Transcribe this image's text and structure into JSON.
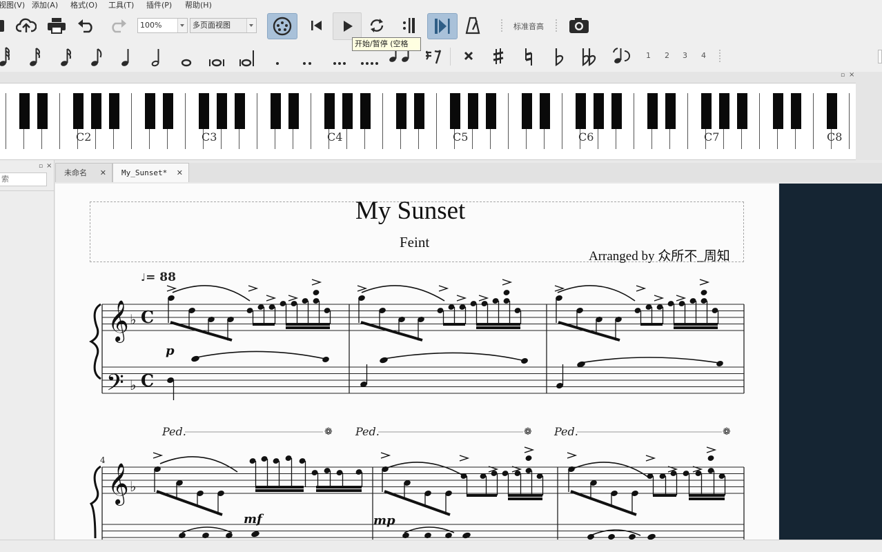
{
  "menu": [
    "视图(V)",
    "添加(A)",
    "格式(O)",
    "工具(T)",
    "插件(P)",
    "帮助(H)"
  ],
  "toolbar": {
    "zoom_value": "100%",
    "view_mode": "多页面视图",
    "concert_pitch_label": "标准音高",
    "tooltip": "开始/暂停 (空格"
  },
  "palette": {
    "voices": [
      "1",
      "2",
      "3",
      "4"
    ]
  },
  "piano": {
    "labels": [
      "C2",
      "C3",
      "C4",
      "C5",
      "C6",
      "C7",
      "C8"
    ]
  },
  "left_dock": {
    "search_placeholder": "索"
  },
  "tabs": [
    {
      "label": "未命名",
      "active": false
    },
    {
      "label": "My_Sunset*",
      "active": true
    }
  ],
  "score": {
    "title": "My Sunset",
    "subtitle": "Feint",
    "arranger": "Arranged by 众所不_周知",
    "tempo_value": "= 88",
    "measure_number": "4",
    "dynamics": [
      "p",
      "mf",
      "mp"
    ],
    "pedal_text": "Ped."
  },
  "colors": {
    "dark_panel": "#152533",
    "active_button": "#a9c1d9",
    "page": "#fbfbfb"
  }
}
